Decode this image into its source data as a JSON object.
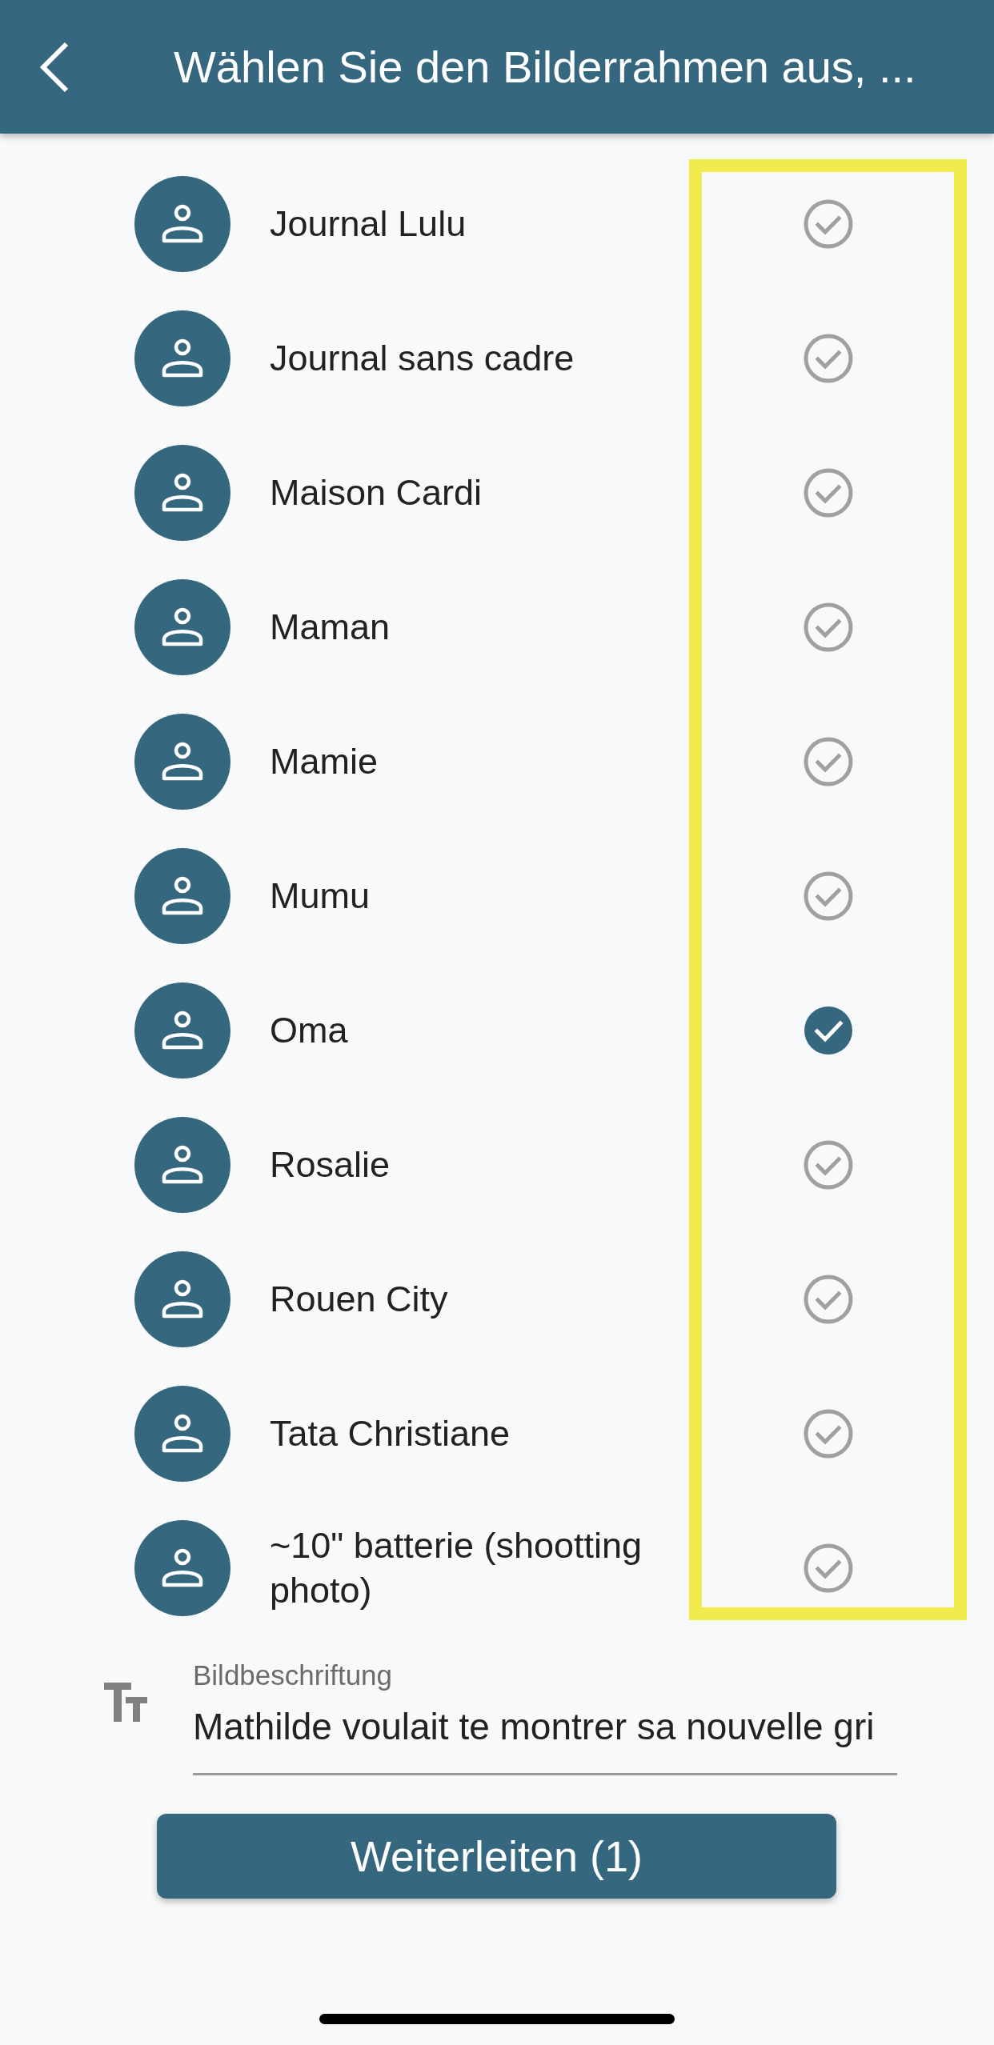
{
  "header": {
    "title": "Wählen Sie den Bilderrahmen aus, ..."
  },
  "frames": [
    {
      "name": "Journal Lulu",
      "selected": false
    },
    {
      "name": "Journal sans cadre",
      "selected": false
    },
    {
      "name": "Maison Cardi",
      "selected": false
    },
    {
      "name": "Maman",
      "selected": false
    },
    {
      "name": "Mamie",
      "selected": false
    },
    {
      "name": "Mumu",
      "selected": false
    },
    {
      "name": "Oma",
      "selected": true
    },
    {
      "name": "Rosalie",
      "selected": false
    },
    {
      "name": "Rouen City",
      "selected": false
    },
    {
      "name": "Tata Christiane",
      "selected": false
    },
    {
      "name": "~10\" batterie (shootting photo)",
      "selected": false
    }
  ],
  "caption": {
    "label": "Bildbeschriftung",
    "value": "Mathilde voulait te montrer sa nouvelle gri"
  },
  "forward_button": {
    "label": "Weiterleiten (1)"
  }
}
